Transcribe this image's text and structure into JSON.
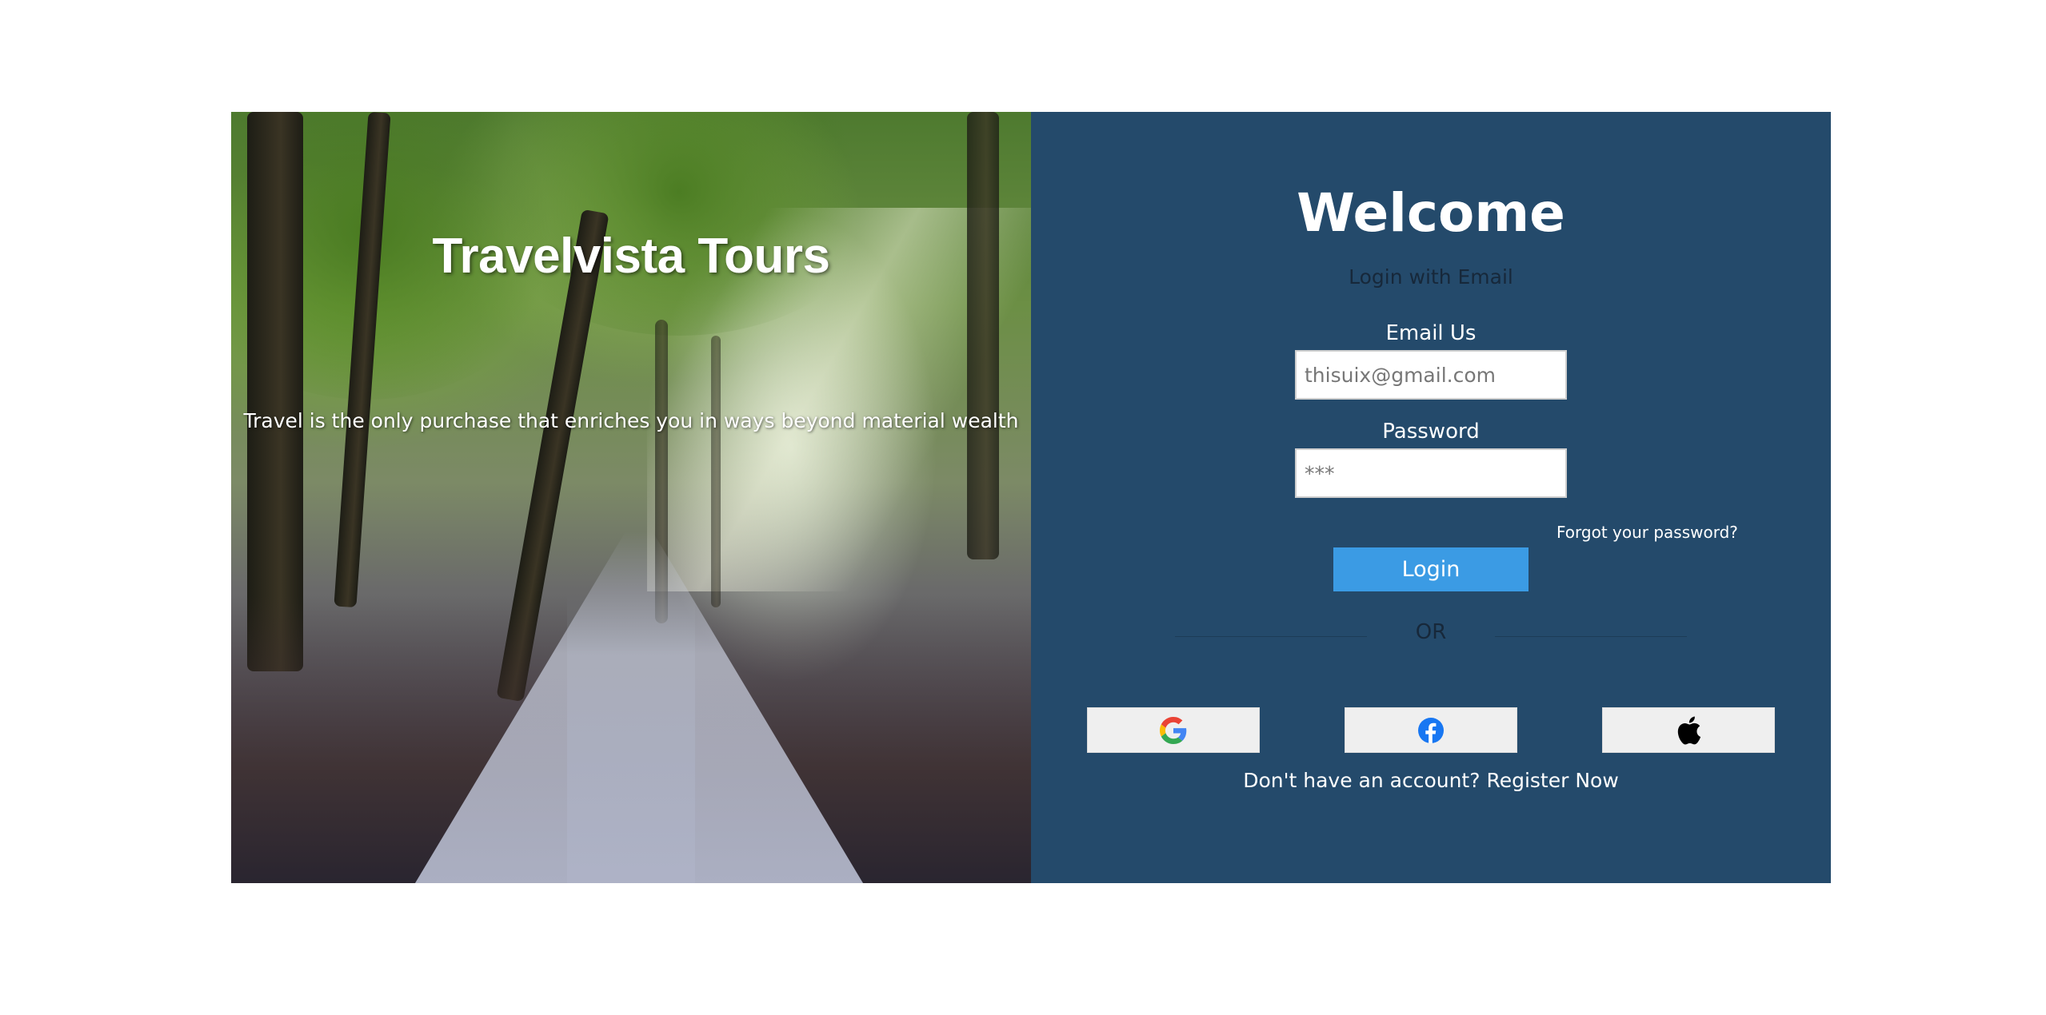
{
  "hero": {
    "title": "Travelvista Tours",
    "tagline": "Travel is the only purchase that enriches you in ways beyond material wealth"
  },
  "login": {
    "heading": "Welcome",
    "subtitle": "Login with Email",
    "email_label": "Email Us",
    "email_placeholder": "thisuix@gmail.com",
    "password_label": "Password",
    "password_placeholder": "***",
    "forgot_link": "Forgot your password?",
    "login_button": "Login",
    "divider_text": "OR",
    "social": [
      {
        "name": "google",
        "icon": "google-icon"
      },
      {
        "name": "facebook",
        "icon": "facebook-icon"
      },
      {
        "name": "apple",
        "icon": "apple-icon"
      }
    ],
    "register_prompt": "Don't have an account?",
    "register_link": "Register Now"
  },
  "colors": {
    "panel_bg": "#244a6b",
    "login_button": "#3b9be4",
    "social_button_bg": "#efefef",
    "facebook_blue": "#1877f2"
  }
}
